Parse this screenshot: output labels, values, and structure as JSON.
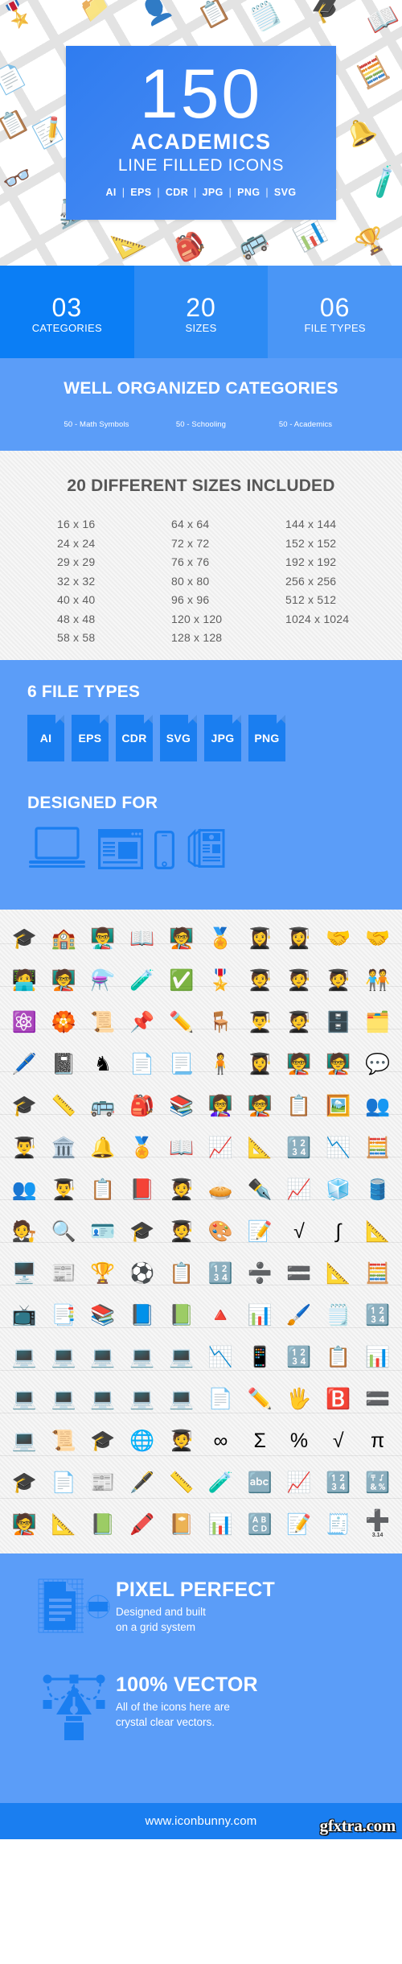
{
  "hero": {
    "number": "150",
    "title": "ACADEMICS",
    "subtitle": "LINE FILLED ICONS",
    "formats": [
      "AI",
      "EPS",
      "CDR",
      "JPG",
      "PNG",
      "SVG"
    ],
    "separator": "|",
    "background_icons": [
      "🎓",
      "👤",
      "📋",
      "📒",
      "📐",
      "🔬",
      "📝",
      "🏫",
      "📖",
      "✏️",
      "🔔",
      "📊",
      "🧪",
      "📌",
      "🏆"
    ],
    "accent_color": "#2f7cf0"
  },
  "stats": [
    {
      "number": "03",
      "label": "CATEGORIES",
      "color": "#0b7ef5"
    },
    {
      "number": "20",
      "label": "SIZES",
      "color": "#2d8bf4"
    },
    {
      "number": "06",
      "label": "FILE TYPES",
      "color": "#4a96f6"
    }
  ],
  "categories": {
    "title": "WELL ORGANIZED CATEGORIES",
    "items": [
      "50 - Math Symbols",
      "50 - Schooling",
      "50 - Academics"
    ],
    "background": "#5b9df8"
  },
  "sizes": {
    "title": "20 DIFFERENT SIZES INCLUDED",
    "columns": [
      [
        "16 x 16",
        "24 x 24",
        "29 x 29",
        "32 x 32",
        "40 x 40",
        "48 x 48",
        "58 x 58"
      ],
      [
        "64 x 64",
        "72 x 72",
        "76 x 76",
        "80 x 80",
        "96 x 96",
        "120 x 120",
        "128 x 128"
      ],
      [
        "144 x 144",
        "152 x 152",
        "192 x 192",
        "256 x 256",
        "512 x 512",
        "1024 x 1024",
        ""
      ]
    ],
    "background": "#eeeeee",
    "text_color": "#5e5e5e"
  },
  "filetypes": {
    "title": "6 FILE TYPES",
    "badges": [
      "AI",
      "EPS",
      "CDR",
      "SVG",
      "JPG",
      "PNG"
    ],
    "badge_color": "#1a7ef0",
    "designed_for_title": "DESIGNED FOR",
    "designed_for_icons": [
      "laptop-icon",
      "browser-window-icon",
      "smartphone-icon",
      "documents-icon"
    ]
  },
  "icon_grid": {
    "columns": 10,
    "rows": 15,
    "icons": [
      "🎓",
      "🏫",
      "👨‍🏫",
      "📖",
      "🧑‍🏫",
      "🏅",
      "👩‍🎓",
      "👩‍🎓",
      "🤝",
      "🤝",
      "🧑‍💻",
      "🧑‍🏫",
      "⚗️",
      "🧪",
      "✅",
      "🎖️",
      "🧑‍🎓",
      "🧑‍🎓",
      "🧑‍🎓",
      "🧑‍🤝‍🧑",
      "⚛️",
      "🏵️",
      "📜",
      "📌",
      "✏️",
      "🪑",
      "👨‍🎓",
      "🧑‍🎓",
      "🗄️",
      "🗂️",
      "🖊️",
      "📓",
      "♞",
      "📄",
      "📃",
      "🧍",
      "👩‍🎓",
      "🧑‍🏫",
      "🧑‍🏫",
      "💬",
      "🎓",
      "📏",
      "🚌",
      "🎒",
      "📚",
      "👩‍🏫",
      "🧑‍🏫",
      "📋",
      "🖼️",
      "👥",
      "👨‍🎓",
      "🏛️",
      "🔔",
      "🏅",
      "📖",
      "📈",
      "📐",
      "🔢",
      "📉",
      "🧮",
      "👥",
      "👨‍🎓",
      "📋",
      "📕",
      "🧑‍🎓",
      "🥧",
      "✒️",
      "📈",
      "🧊",
      "🛢️",
      "🧑‍⚖️",
      "🔍",
      "🪪",
      "🎓",
      "🧑‍🎓",
      "🎨",
      "📝",
      "√",
      "∫",
      "📐",
      "🖥️",
      "📰",
      "🏆",
      "⚽",
      "📋",
      "🔢",
      "➗",
      "🟰",
      "📐",
      "🧮",
      "📺",
      "📑",
      "📚",
      "📘",
      "📗",
      "🔺",
      "📊",
      "🖌️",
      "🗒️",
      "🔢",
      "💻",
      "💻",
      "💻",
      "💻",
      "💻",
      "📉",
      "📱",
      "🔢",
      "📋",
      "📊",
      "💻",
      "💻",
      "💻",
      "💻",
      "💻",
      "📄",
      "✏️",
      "🖐️",
      "🅱️",
      "🟰",
      "💻",
      "📜",
      "🎓",
      "🌐",
      "🧑‍🎓",
      "∞",
      "Σ",
      "%",
      "√",
      "π",
      "🎓",
      "📄",
      "📰",
      "🖋️",
      "📏",
      "🧪",
      "🔤",
      "📈",
      "🔢",
      "🔣",
      "🧑‍🏫",
      "📐",
      "📗",
      "🖍️",
      "📔",
      "📊",
      "🔠",
      "📝",
      "🧾",
      "➕"
    ],
    "annotation": "3.14"
  },
  "features": [
    {
      "icon": "pixel-grid-icon",
      "heading": "PIXEL PERFECT",
      "line1": "Designed and built",
      "line2": "on a grid system"
    },
    {
      "icon": "pen-tool-icon",
      "heading": "100% VECTOR",
      "line1": "All of the icons here are",
      "line2": "crystal clear vectors."
    }
  ],
  "footer": {
    "url": "www.iconbunny.com",
    "watermark": "gfxtra.com",
    "background": "#1a7ef0"
  }
}
